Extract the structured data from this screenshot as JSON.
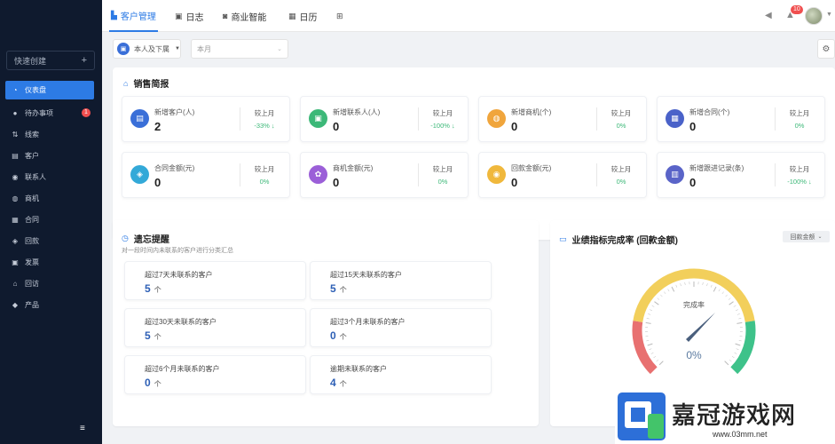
{
  "sidebar": {
    "quick_create": "快速创建",
    "quick_create_plus": "+",
    "items": [
      {
        "label": "仪表盘",
        "icon": "dashboard-icon",
        "active": true
      },
      {
        "label": "待办事项",
        "icon": "chat-icon",
        "badge": "1"
      },
      {
        "label": "线索",
        "icon": "sort-icon"
      },
      {
        "label": "客户",
        "icon": "customer-icon"
      },
      {
        "label": "联系人",
        "icon": "contact-icon"
      },
      {
        "label": "商机",
        "icon": "opportunity-icon"
      },
      {
        "label": "合同",
        "icon": "contract-icon"
      },
      {
        "label": "回款",
        "icon": "moneybag-icon"
      },
      {
        "label": "发票",
        "icon": "invoice-icon"
      },
      {
        "label": "回访",
        "icon": "visit-icon"
      },
      {
        "label": "产品",
        "icon": "product-icon"
      }
    ],
    "collapse_icon": "menu-collapse-icon"
  },
  "topbar": {
    "tabs": [
      {
        "label": "客户管理",
        "icon": "chart-icon",
        "active": true
      },
      {
        "label": "日志",
        "icon": "log-icon"
      },
      {
        "label": "商业智能",
        "icon": "shield-icon"
      },
      {
        "label": "日历",
        "icon": "calendar-icon"
      },
      {
        "label": "",
        "icon": "grid-icon"
      }
    ],
    "notification_count": "10",
    "accent": "#2d7be5"
  },
  "filters": {
    "scope": "本人及下属",
    "period_placeholder": "本月"
  },
  "sales": {
    "title": "销售简报",
    "compare_label": "较上月",
    "stats": [
      {
        "label": "新增客户(人)",
        "value": "2",
        "change": "-33% ↓",
        "color": "#3a6fd8",
        "icon": "document-icon"
      },
      {
        "label": "新增联系人(人)",
        "value": "0",
        "change": "-100% ↓",
        "color": "#3cb878",
        "icon": "contact-card-icon"
      },
      {
        "label": "新增商机(个)",
        "value": "0",
        "change": "0%",
        "color": "#f0a53c",
        "icon": "opportunity-icon"
      },
      {
        "label": "新增合同(个)",
        "value": "0",
        "change": "0%",
        "color": "#4a62c9",
        "icon": "contract-icon"
      },
      {
        "label": "合同金额(元)",
        "value": "0",
        "change": "0%",
        "color": "#33a9d8",
        "icon": "moneybag-icon"
      },
      {
        "label": "商机金额(元)",
        "value": "0",
        "change": "0%",
        "color": "#9b5fd8",
        "icon": "gear-icon"
      },
      {
        "label": "回款金额(元)",
        "value": "0",
        "change": "0%",
        "color": "#f0b83c",
        "icon": "coin-bag-icon"
      },
      {
        "label": "新增跟进记录(条)",
        "value": "0",
        "change": "-100% ↓",
        "color": "#5a64c8",
        "icon": "record-icon"
      }
    ]
  },
  "memo": {
    "title": "遗忘提醒",
    "subtitle": "对一段时间内未联系的客户进行分类汇总",
    "unit": "个",
    "items": [
      {
        "label": "超过7天未联系的客户",
        "value": "5"
      },
      {
        "label": "超过15天未联系的客户",
        "value": "5"
      },
      {
        "label": "超过30天未联系的客户",
        "value": "5"
      },
      {
        "label": "超过3个月未联系的客户",
        "value": "0"
      },
      {
        "label": "超过6个月未联系的客户",
        "value": "0"
      },
      {
        "label": "逾期未联系的客户",
        "value": "4"
      }
    ]
  },
  "performance": {
    "title": "业绩指标完成率 (回款金额)",
    "select": "回款金额",
    "gauge_label": "完成率",
    "gauge_value": "0%",
    "completion": 0
  },
  "watermark": {
    "logo_text": "嘉冠游戏网",
    "url": "www.03mm.net"
  }
}
